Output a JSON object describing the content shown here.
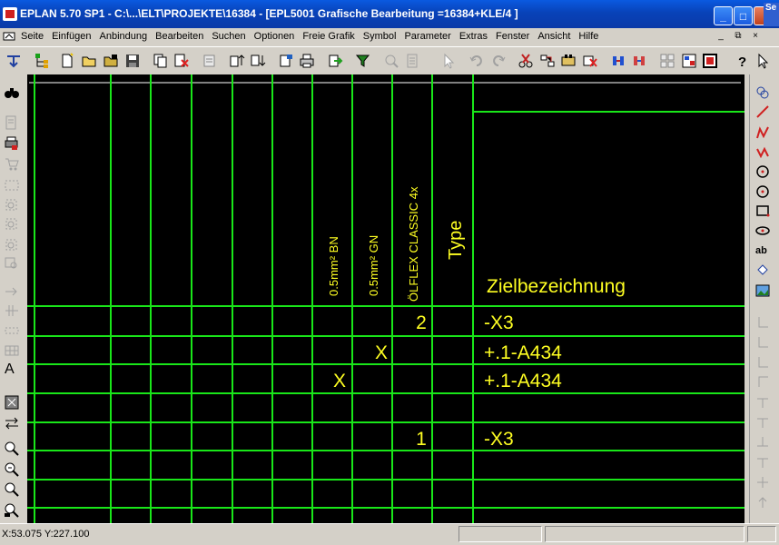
{
  "window": {
    "title": "EPLAN 5.70 SP1 - C:\\...\\ELT\\PROJEKTE\\16384 - [EPL5001 Grafische Bearbeitung =16384+KLE/4    ]",
    "corner_tab_text": "Se",
    "minimize": "_",
    "maximize": "□",
    "close": "✕"
  },
  "menu": {
    "items": [
      "Seite",
      "Einfügen",
      "Anbindung",
      "Bearbeiten",
      "Suchen",
      "Optionen",
      "Freie Grafik",
      "Symbol",
      "Parameter",
      "Extras",
      "Fenster",
      "Ansicht",
      "Hilfe"
    ],
    "mdi_minimize": "_",
    "mdi_restore": "⧉",
    "mdi_close": "×"
  },
  "canvas": {
    "colors": {
      "background": "#000000",
      "grid": "#19e619",
      "text": "#ffff22",
      "white_line": "#ffffff"
    },
    "header_vertical": [
      {
        "name": "header-0-5mm-bn",
        "text": "0.5mm² BN"
      },
      {
        "name": "header-0-5mm-gn",
        "text": "0.5mm² GN"
      },
      {
        "name": "header-oelflex",
        "text": "ÖLFLEX CLASSIC 4x"
      },
      {
        "name": "header-type",
        "text": "Type"
      }
    ],
    "header_target": "Zielbezeichnung",
    "rows": [
      {
        "bn": "",
        "gn": "",
        "core": "2",
        "target": "-X3"
      },
      {
        "bn": "",
        "gn": "X",
        "core": "",
        "target": "+.1-A434"
      },
      {
        "bn": "X",
        "gn": "",
        "core": "",
        "target": "+.1-A434"
      },
      {
        "bn": "",
        "gn": "",
        "core": "",
        "target": ""
      },
      {
        "bn": "",
        "gn": "",
        "core": "1",
        "target": "-X3"
      }
    ]
  },
  "left_toolbar": {
    "text_tool_glyph": "A"
  },
  "right_toolbar": {
    "text_label": "ab"
  },
  "status": {
    "coords": "X:53.075 Y:227.100"
  }
}
